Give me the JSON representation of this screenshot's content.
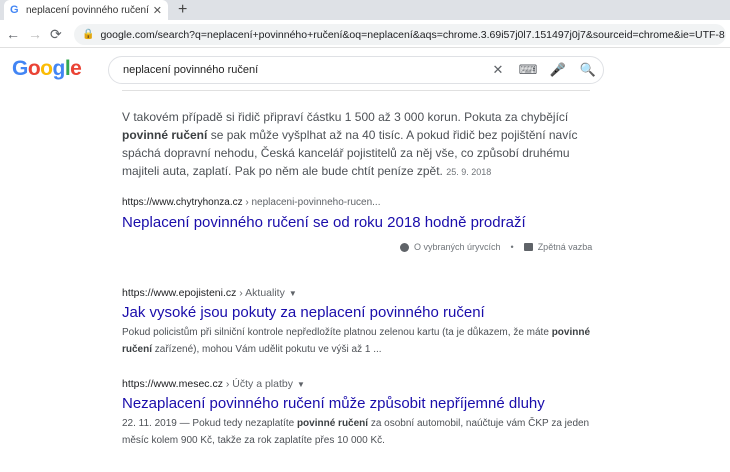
{
  "tab": {
    "title": "neplacení povinného ručení - Hle",
    "close": "✕",
    "new": "+"
  },
  "nav": {
    "back": "←",
    "forward": "→",
    "reload": "⟳"
  },
  "omnibox": {
    "url": "google.com/search?q=neplacení+povinného+ručení&oq=neplacení&aqs=chrome.3.69i57j0l7.151497j0j7&sourceid=chrome&ie=UTF-8"
  },
  "logo": [
    "G",
    "o",
    "o",
    "g",
    "l",
    "e"
  ],
  "search": {
    "query": "neplacení povinného ručení"
  },
  "featured": {
    "snippet_1": "V takovém případě si řidič připraví částku 1 500 až 3 000 korun. Pokuta za chybějící ",
    "snippet_bold": "povinné ručení",
    "snippet_2": " se pak může vyšplhat až na 40 tisíc. A pokud řidič bez pojištění navíc spáchá dopravní nehodu, Česká kancelář pojistitelů za něj vše, co způsobí druhému majiteli auta, zaplatí. Pak po něm ale bude chtít peníze zpět.",
    "date": "25. 9. 2018",
    "cite_domain": "https://www.chytryhonza.cz",
    "cite_path": " › neplaceni-povinneho-rucen...",
    "title": "Neplacení povinného ručení se od roku 2018 hodně prodraží",
    "footer_about": "O vybraných úryvcích",
    "footer_dot": "•",
    "footer_feedback": "Zpětná vazba"
  },
  "results": [
    {
      "domain": "https://www.epojisteni.cz",
      "path": " › Aktuality",
      "title": "Jak vysoké jsou pokuty za neplacení povinného ručení",
      "snip_1": "Pokud policistům při silniční kontrole nepředložíte platnou zelenou kartu (ta je důkazem, že máte ",
      "snip_bold": "povinné ručení",
      "snip_2": " zařízené), mohou Vám udělit pokutu ve výši až 1 ..."
    },
    {
      "domain": "https://www.mesec.cz",
      "path": " › Účty a platby",
      "title": "Nezaplacení povinného ručení může způsobit nepříjemné dluhy",
      "snip_1": "22. 11. 2019 — Pokud tedy nezaplatíte ",
      "snip_bold": "povinné ručení",
      "snip_2": " za osobní automobil, naúčtuje vám ČKP za jeden měsíc kolem 900 Kč, takže za rok zaplatíte přes 10 000 Kč."
    }
  ]
}
